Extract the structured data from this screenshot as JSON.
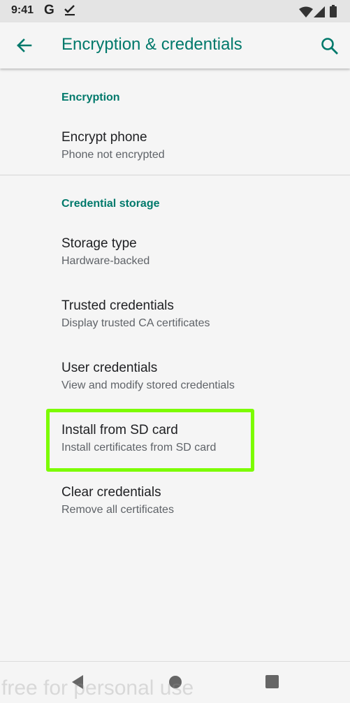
{
  "status_bar": {
    "time": "9:41",
    "g_label": "G",
    "icons": [
      "check-icon",
      "wifi-icon",
      "signal-icon",
      "battery-icon"
    ]
  },
  "app_bar": {
    "title": "Encryption & credentials",
    "back_icon": "arrow-back-icon",
    "search_icon": "search-icon"
  },
  "sections": {
    "encryption": {
      "header": "Encryption",
      "items": [
        {
          "title": "Encrypt phone",
          "summary": "Phone not encrypted"
        }
      ]
    },
    "credential_storage": {
      "header": "Credential storage",
      "items": [
        {
          "title": "Storage type",
          "summary": "Hardware-backed"
        },
        {
          "title": "Trusted credentials",
          "summary": "Display trusted CA certificates"
        },
        {
          "title": "User credentials",
          "summary": "View and modify stored credentials"
        },
        {
          "title": "Install from SD card",
          "summary": "Install certificates from SD card"
        },
        {
          "title": "Clear credentials",
          "summary": "Remove all certificates"
        }
      ]
    }
  },
  "nav_bar": {
    "icons": [
      "nav-back-icon",
      "home-icon",
      "recents-icon"
    ]
  },
  "watermark": "free for personal use",
  "colors": {
    "accent": "#00796b",
    "highlight": "#7cfc00",
    "background": "#f5f5f5",
    "status_bar": "#e4e4e4"
  }
}
